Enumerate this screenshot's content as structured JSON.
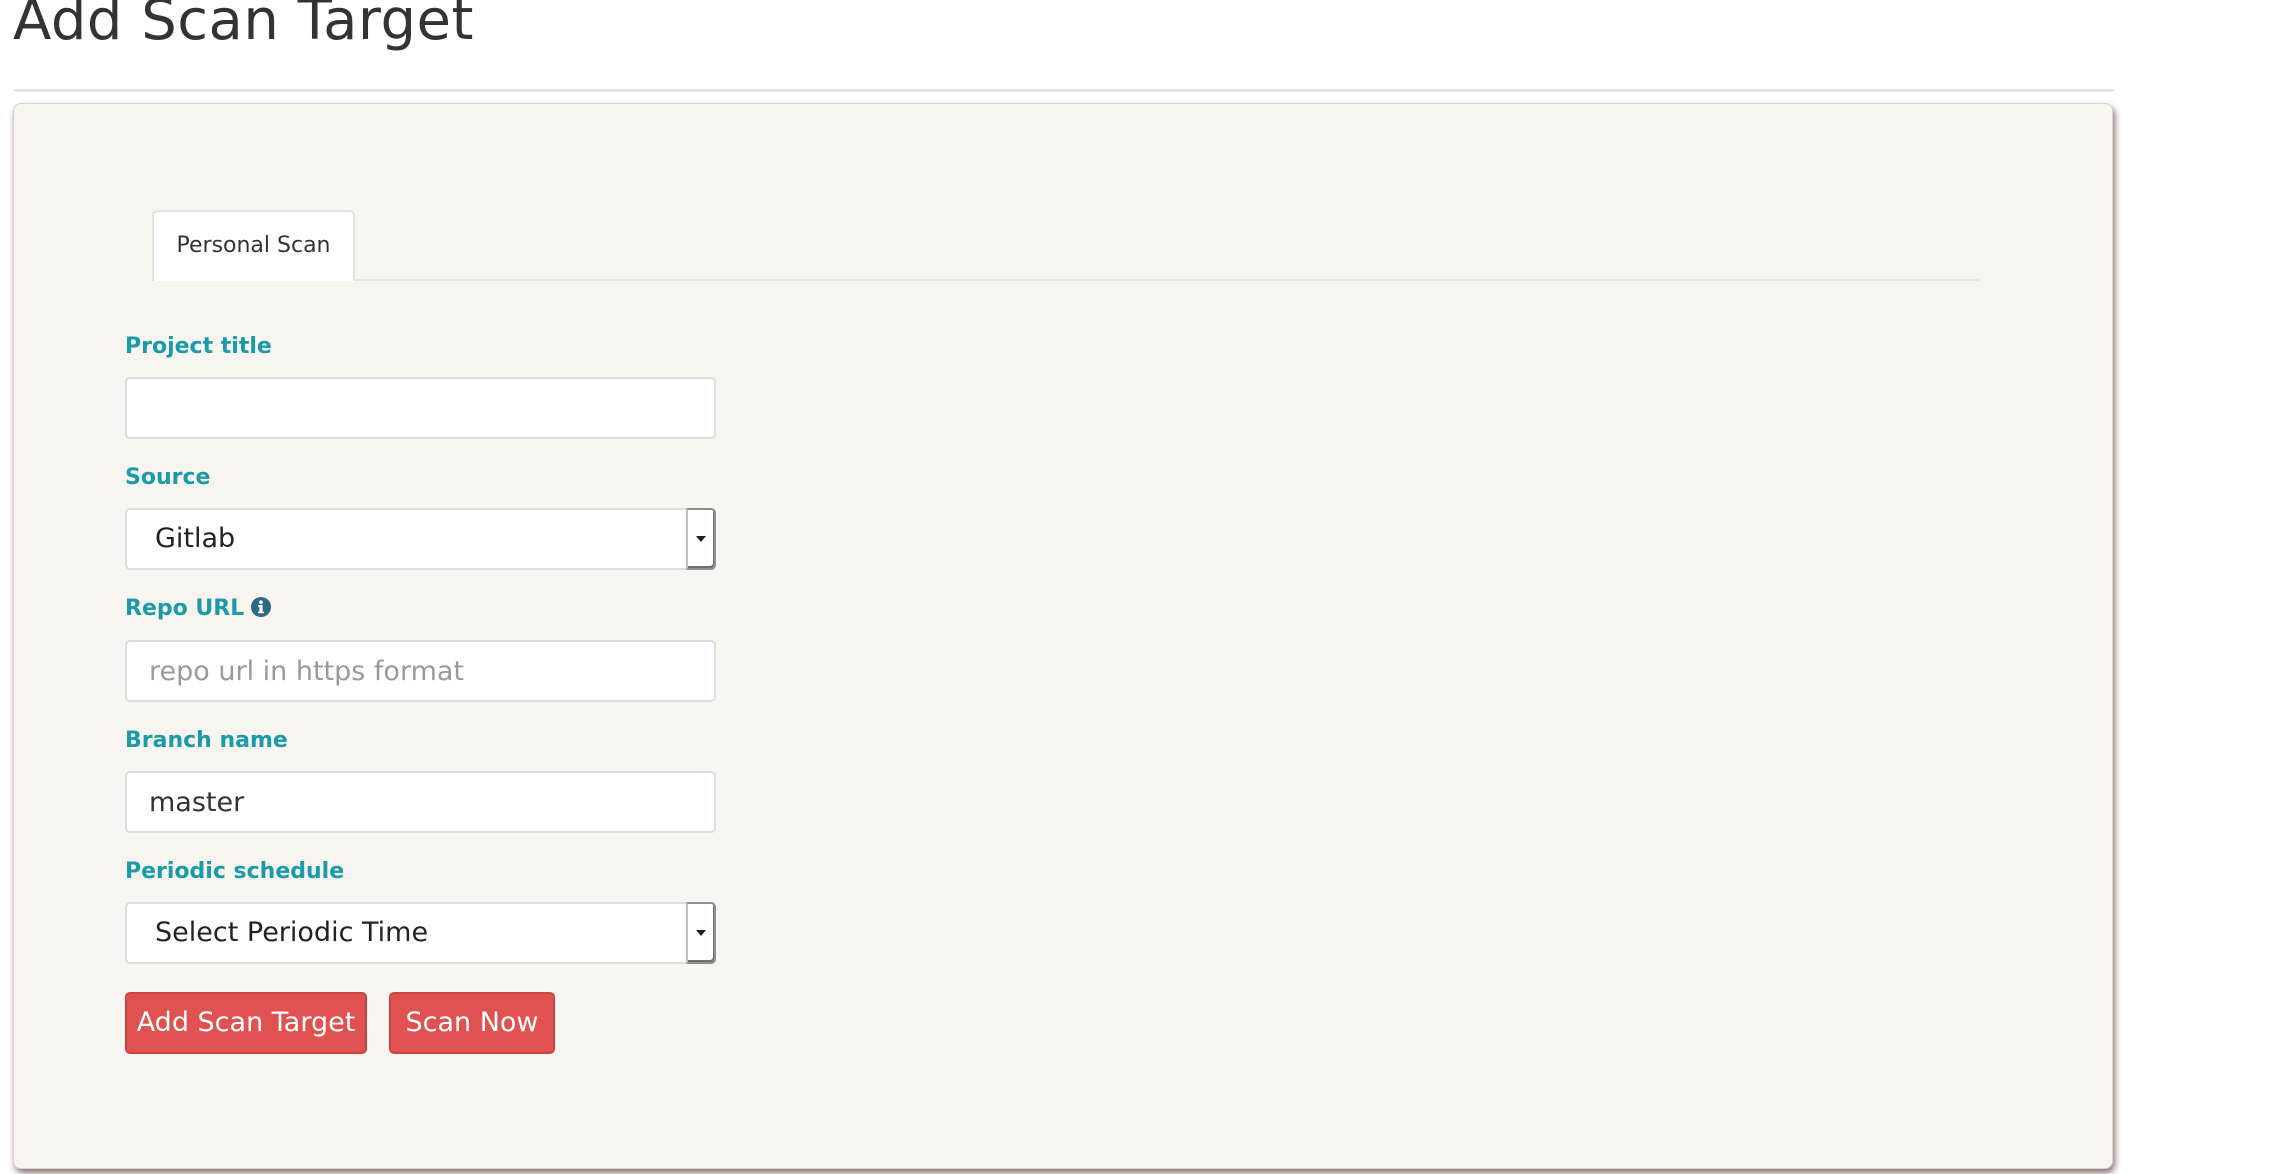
{
  "page": {
    "title": "Add Scan Target"
  },
  "tabs": [
    {
      "label": "Personal Scan",
      "active": true
    }
  ],
  "form": {
    "project_title": {
      "label": "Project title",
      "value": "",
      "placeholder": ""
    },
    "source": {
      "label": "Source",
      "selected": "Gitlab"
    },
    "repo_url": {
      "label": "Repo URL",
      "info_icon": "info-circle-icon",
      "value": "",
      "placeholder": "repo url in https format"
    },
    "branch_name": {
      "label": "Branch name",
      "value": "master"
    },
    "periodic_schedule": {
      "label": "Periodic schedule",
      "selected": "Select Periodic Time"
    }
  },
  "actions": {
    "add_scan_target_label": "Add Scan Target",
    "scan_now_label": "Scan Now"
  },
  "colors": {
    "label_accent": "#1b9aaa",
    "button_primary": "#e05250",
    "card_background": "#f8f4ef",
    "info_icon": "#2e6a86"
  }
}
